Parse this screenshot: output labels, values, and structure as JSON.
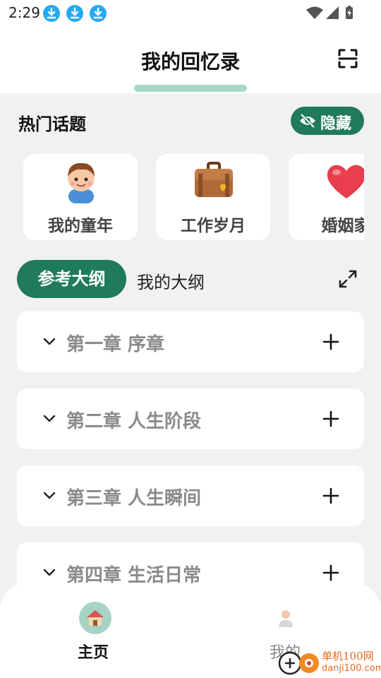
{
  "status_bar": {
    "time": "2:29",
    "notifications": [
      "download-icon",
      "download-icon",
      "download-icon"
    ],
    "right_icons": [
      "wifi-icon",
      "signal-icon",
      "battery-icon"
    ]
  },
  "header": {
    "title": "我的回忆录",
    "action_icon": "scan-icon"
  },
  "hot_topics": {
    "title": "热门话题",
    "hide_label": "隐藏",
    "items": [
      {
        "label": "我的童年",
        "icon": "child-icon"
      },
      {
        "label": "工作岁月",
        "icon": "briefcase-icon"
      },
      {
        "label": "婚姻家",
        "icon": "heart-icon"
      }
    ]
  },
  "outline_tabs": {
    "active": "参考大纲",
    "inactive": "我的大纲",
    "expand_icon": "expand-icon"
  },
  "chapters": [
    {
      "title": "第一章 序章"
    },
    {
      "title": "第二章 人生阶段"
    },
    {
      "title": "第三章 人生瞬间"
    },
    {
      "title": "第四章 生活日常"
    }
  ],
  "bottom_nav": {
    "items": [
      {
        "label": "主页",
        "icon": "home-icon",
        "active": true
      },
      {
        "label": "我的",
        "icon": "user-icon",
        "active": false
      }
    ]
  },
  "watermark": {
    "name": "单机100网",
    "url": "danji100.com"
  },
  "colors": {
    "accent": "#1f7a5e",
    "accent_light": "#a6d8cc",
    "download_badge": "#27a9f0",
    "chapter_text": "#8a8a8a",
    "watermark": "#e96a1d"
  }
}
